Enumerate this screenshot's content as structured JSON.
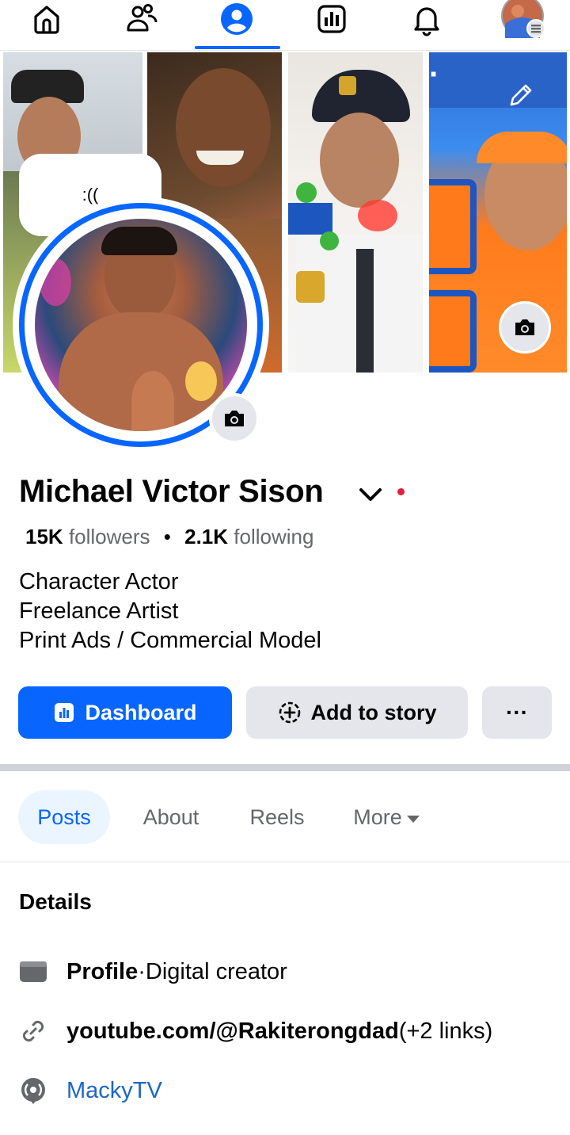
{
  "nav": {
    "items": [
      {
        "name": "home",
        "icon": "home-icon"
      },
      {
        "name": "friends",
        "icon": "friends-icon"
      },
      {
        "name": "profile",
        "icon": "profile-icon",
        "active": true
      },
      {
        "name": "dashboard",
        "icon": "dashboard-icon"
      },
      {
        "name": "notifications",
        "icon": "bell-icon"
      },
      {
        "name": "menu",
        "icon": "avatar-menu-icon"
      }
    ],
    "accent": "#0866ff"
  },
  "bubble": {
    "text": ":(("
  },
  "profile": {
    "name": "Michael Victor Sison",
    "followers_count": "15K",
    "followers_label": "followers",
    "separator": "•",
    "following_count": "2.1K",
    "following_label": "following",
    "bio": [
      "Character Actor",
      "Freelance Artist",
      "Print Ads / Commercial Model"
    ]
  },
  "actions": {
    "dashboard_label": "Dashboard",
    "add_story_label": "Add to story",
    "more_label": "···"
  },
  "tabs": {
    "items": [
      {
        "label": "Posts",
        "active": true
      },
      {
        "label": "About"
      },
      {
        "label": "Reels"
      },
      {
        "label": "More"
      }
    ]
  },
  "details": {
    "title": "Details",
    "profile_type_label": "Profile",
    "profile_type_sep": " · ",
    "profile_type_value": "Digital creator",
    "link_main": "youtube.com/@Rakiterongdad",
    "link_extra": " (+2 links)",
    "page_name": "MackyTV"
  }
}
